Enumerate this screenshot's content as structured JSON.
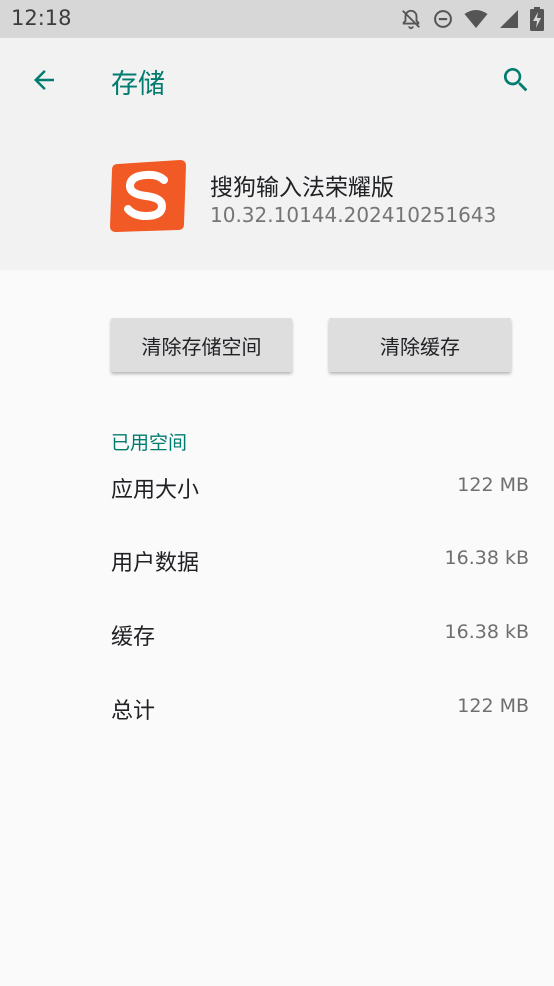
{
  "status_bar": {
    "time": "12:18",
    "icons": [
      "notifications-off-icon",
      "do-not-disturb-icon",
      "wifi-icon",
      "signal-icon",
      "battery-charging-icon"
    ]
  },
  "toolbar": {
    "title": "存储",
    "back_icon": "arrow-back-icon",
    "search_icon": "search-icon"
  },
  "app": {
    "name": "搜狗输入法荣耀版",
    "version": "10.32.10144.202410251643",
    "icon": "sogou-s-icon"
  },
  "actions": {
    "clear_storage_label": "清除存储空间",
    "clear_cache_label": "清除缓存"
  },
  "storage": {
    "section_title": "已用空间",
    "rows": [
      {
        "label": "应用大小",
        "value": "122 MB"
      },
      {
        "label": "用户数据",
        "value": "16.38 kB"
      },
      {
        "label": "缓存",
        "value": "16.38 kB"
      },
      {
        "label": "总计",
        "value": "122 MB"
      }
    ]
  },
  "colors": {
    "accent": "#017c6f",
    "status_bar": "#d7d7d7",
    "header_bg": "#f2f2f2",
    "body_bg": "#fafafa",
    "button_bg": "#dedede",
    "app_icon_orange": "#f15a24"
  }
}
